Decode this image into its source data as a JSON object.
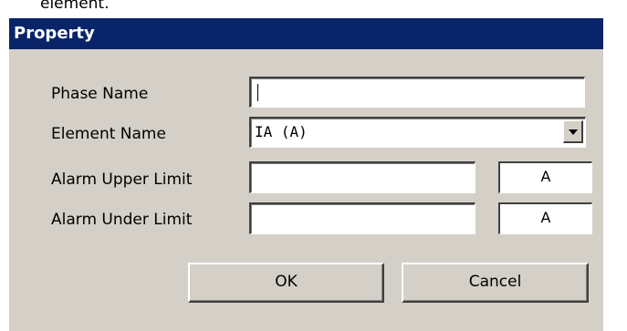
{
  "top_fragment": "element.",
  "dialog": {
    "title": "Property",
    "fields": {
      "phase_name": {
        "label": "Phase Name",
        "value": ""
      },
      "element_name": {
        "label": "Element Name",
        "value": "IA (A)"
      },
      "alarm_upper": {
        "label": "Alarm Upper Limit",
        "value": "",
        "unit": "A"
      },
      "alarm_under": {
        "label": "Alarm Under Limit",
        "value": "",
        "unit": "A"
      }
    },
    "buttons": {
      "ok": "OK",
      "cancel": "Cancel"
    }
  },
  "colors": {
    "titlebar": "#0a246a",
    "dialog_bg": "#d4d0c8"
  }
}
